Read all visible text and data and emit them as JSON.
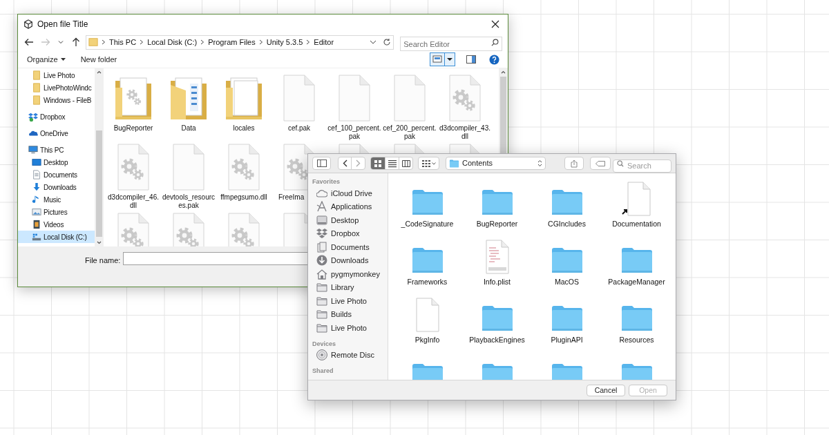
{
  "windows_dialog": {
    "title": "Open file Title",
    "nav_buttons": [
      {
        "kind": "back",
        "disabled": false
      },
      {
        "kind": "forward",
        "disabled": true
      },
      {
        "kind": "recent",
        "disabled": false
      },
      {
        "kind": "up",
        "disabled": false
      }
    ],
    "breadcrumb": [
      "This PC",
      "Local Disk (C:)",
      "Program Files",
      "Unity 5.3.5",
      "Editor"
    ],
    "search": {
      "placeholder": "Search Editor"
    },
    "toolbar": {
      "organize": "Organize",
      "new_folder": "New folder",
      "view_selected": true
    },
    "sidebar": {
      "groups": [
        {
          "items": [
            {
              "label": "Live Photo",
              "kind": "folder",
              "selected": false
            },
            {
              "label": "LivePhotoWindc",
              "kind": "folder",
              "selected": false
            },
            {
              "label": "Windows - FileB",
              "kind": "folder",
              "selected": false
            }
          ]
        },
        {
          "items": [
            {
              "label": "Dropbox",
              "kind": "dropbox",
              "selected": false
            }
          ]
        },
        {
          "items": [
            {
              "label": "OneDrive",
              "kind": "onedrive",
              "selected": false
            }
          ]
        },
        {
          "items": [
            {
              "label": "This PC",
              "kind": "pc",
              "selected": false,
              "children": [
                {
                  "label": "Desktop",
                  "kind": "desktop",
                  "selected": false
                },
                {
                  "label": "Documents",
                  "kind": "documents",
                  "selected": false
                },
                {
                  "label": "Downloads",
                  "kind": "downloads",
                  "selected": false
                },
                {
                  "label": "Music",
                  "kind": "music",
                  "selected": false
                },
                {
                  "label": "Pictures",
                  "kind": "pictures",
                  "selected": false
                },
                {
                  "label": "Videos",
                  "kind": "videos",
                  "selected": false
                },
                {
                  "label": "Local Disk (C:)",
                  "kind": "drive",
                  "selected": true
                }
              ]
            }
          ]
        }
      ]
    },
    "files": [
      {
        "name": "BugReporter",
        "kind": "folder_gear"
      },
      {
        "name": "Data",
        "kind": "folder_docs"
      },
      {
        "name": "locales",
        "kind": "folder_pages"
      },
      {
        "name": "cef.pak",
        "kind": "blank"
      },
      {
        "name": "cef_100_percent.pak",
        "kind": "blank"
      },
      {
        "name": "cef_200_percent.pak",
        "kind": "blank"
      },
      {
        "name": "d3dcompiler_43.dll",
        "kind": "gear"
      },
      {
        "name": "d3dcompiler_46.dll",
        "kind": "gear"
      },
      {
        "name": "devtools_resources.pak",
        "kind": "blank"
      },
      {
        "name": "ffmpegsumo.dll",
        "kind": "gear"
      },
      {
        "name": "FreeIma",
        "kind": "gear",
        "cut": true
      },
      {
        "kind": "blank"
      },
      {
        "kind": "blank"
      },
      {
        "kind": "gear"
      },
      {
        "kind": "gear"
      },
      {
        "kind": "gear"
      },
      {
        "kind": "gear"
      },
      {
        "kind": "blank"
      }
    ],
    "file_name": {
      "label": "File name:"
    }
  },
  "mac_dialog": {
    "view_buttons": [
      {
        "kind": "icons",
        "selected": true
      },
      {
        "kind": "list",
        "selected": false
      },
      {
        "kind": "columns",
        "selected": false
      }
    ],
    "path": "Contents",
    "search": {
      "placeholder": "Search"
    },
    "sidebar": [
      {
        "heading": "Favorites",
        "items": [
          {
            "label": "iCloud Drive",
            "kind": "icloud",
            "selected": false
          },
          {
            "label": "Applications",
            "kind": "applications",
            "selected": false
          },
          {
            "label": "Desktop",
            "kind": "desktop",
            "selected": false
          },
          {
            "label": "Dropbox",
            "kind": "dropbox",
            "selected": false
          },
          {
            "label": "Documents",
            "kind": "documents",
            "selected": false
          },
          {
            "label": "Downloads",
            "kind": "downloads",
            "selected": false
          },
          {
            "label": "pygmymonkey",
            "kind": "home",
            "selected": false
          },
          {
            "label": "Library",
            "kind": "folder",
            "selected": false
          },
          {
            "label": "Live Photo",
            "kind": "folder",
            "selected": false
          },
          {
            "label": "Builds",
            "kind": "folder",
            "selected": false
          },
          {
            "label": "Live Photo",
            "kind": "folder",
            "selected": false
          }
        ]
      },
      {
        "heading": "Devices",
        "items": [
          {
            "label": "Remote Disc",
            "kind": "disc",
            "selected": false
          }
        ]
      },
      {
        "heading": "Shared"
      }
    ],
    "files": [
      {
        "name": "_CodeSignature",
        "kind": "folder"
      },
      {
        "name": "BugReporter",
        "kind": "folder"
      },
      {
        "name": "CGIncludes",
        "kind": "folder"
      },
      {
        "name": "Documentation",
        "kind": "alias"
      },
      {
        "name": "Frameworks",
        "kind": "folder"
      },
      {
        "name": "Info.plist",
        "kind": "plist"
      },
      {
        "name": "MacOS",
        "kind": "folder"
      },
      {
        "name": "PackageManager",
        "kind": "folder"
      },
      {
        "name": "PkgInfo",
        "kind": "document"
      },
      {
        "name": "PlaybackEngines",
        "kind": "folder"
      },
      {
        "name": "PluginAPI",
        "kind": "folder"
      },
      {
        "name": "Resources",
        "kind": "folder"
      },
      {
        "kind": "folder"
      },
      {
        "kind": "folder"
      },
      {
        "kind": "folder"
      },
      {
        "kind": "folder"
      }
    ],
    "buttons": [
      {
        "label": "Cancel",
        "disabled": false
      },
      {
        "label": "Open",
        "disabled": true
      }
    ]
  }
}
